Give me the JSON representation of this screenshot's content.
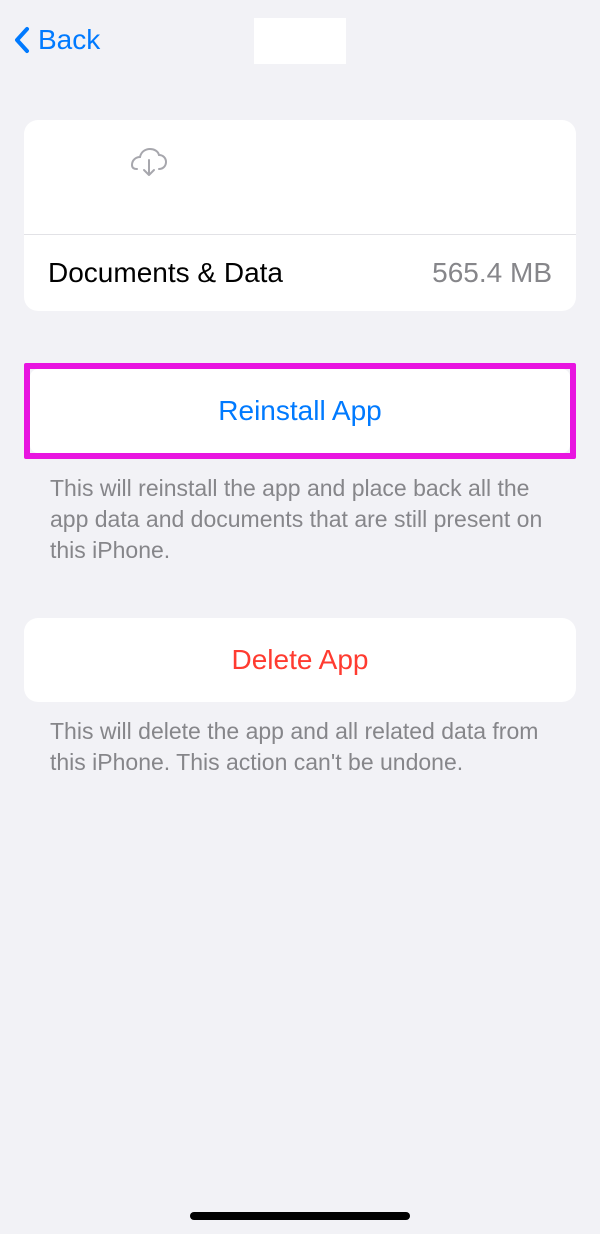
{
  "nav": {
    "back_label": "Back"
  },
  "storage": {
    "documents_label": "Documents & Data",
    "documents_value": "565.4 MB"
  },
  "actions": {
    "reinstall_label": "Reinstall App",
    "reinstall_description": "This will reinstall the app and place back all the app data and documents that are still present on this iPhone.",
    "delete_label": "Delete App",
    "delete_description": "This will delete the app and all related data from this iPhone. This action can't be undone."
  }
}
